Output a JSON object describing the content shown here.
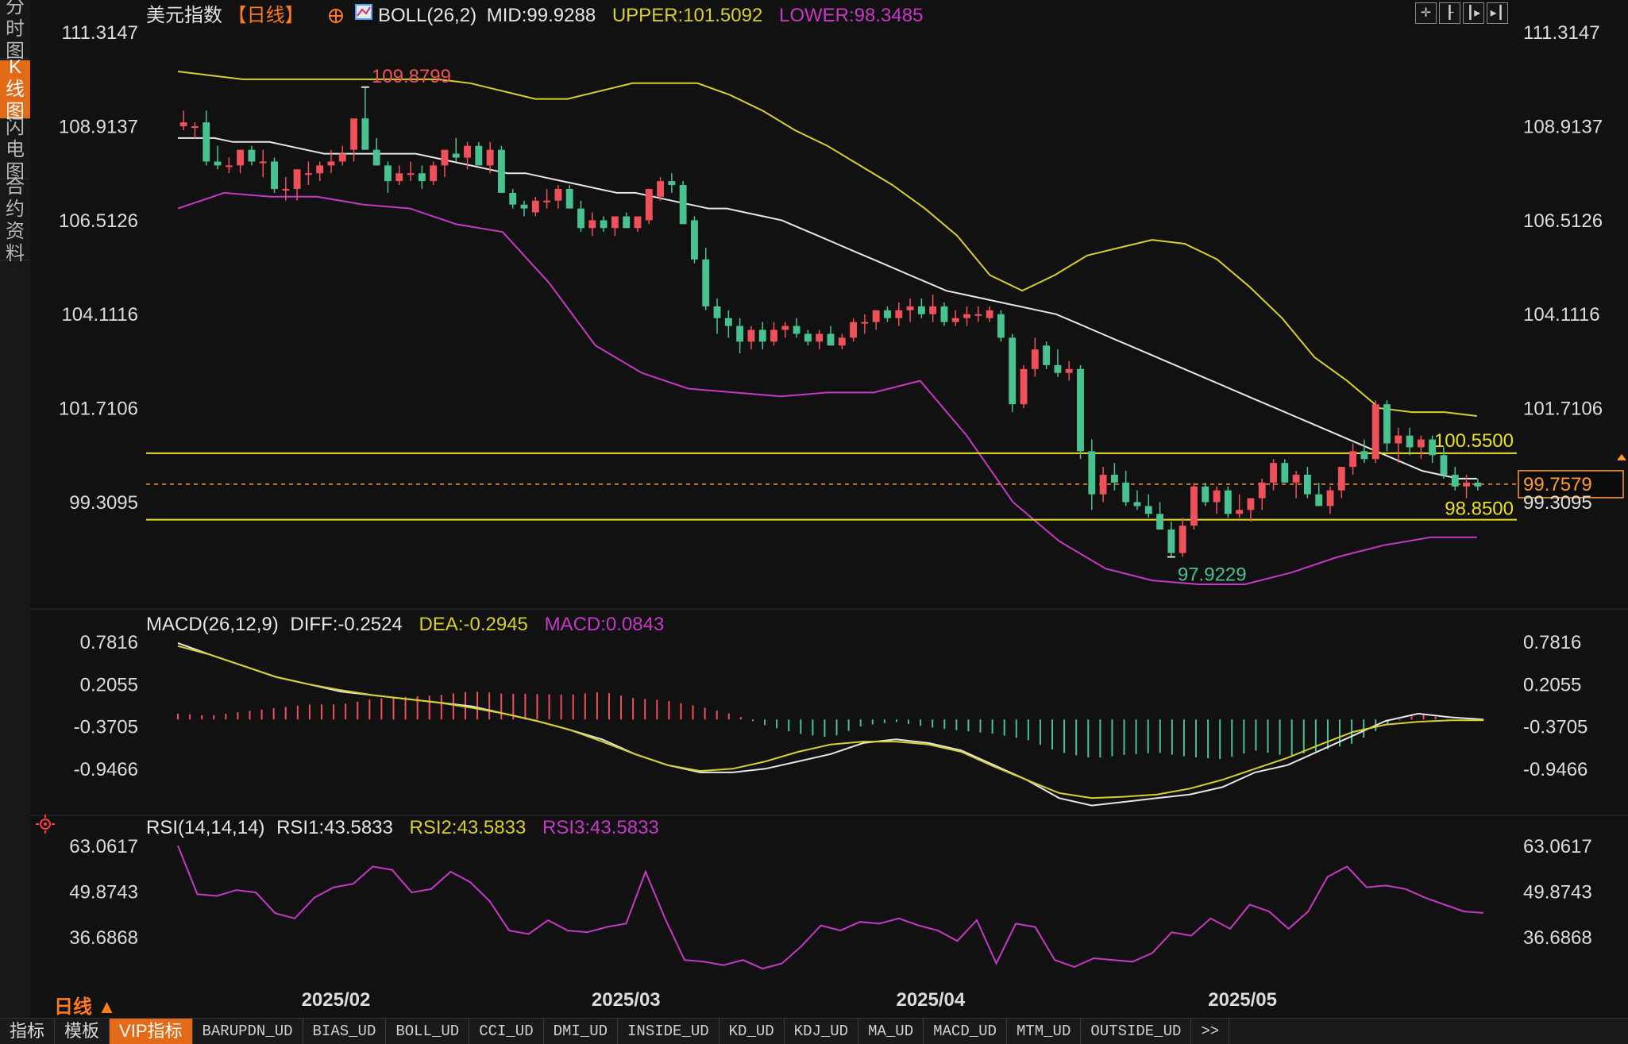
{
  "rail_tabs": [
    {
      "label": "分时图",
      "chars": [
        "分",
        "时",
        "图"
      ],
      "active": false
    },
    {
      "label": "K线图",
      "chars": [
        "K",
        "线",
        "图"
      ],
      "active": true
    },
    {
      "label": "闪电图",
      "chars": [
        "闪",
        "电",
        "图"
      ],
      "active": false
    },
    {
      "label": "合约资料",
      "chars": [
        "合",
        "约",
        "资",
        "料"
      ],
      "active": false
    }
  ],
  "header": {
    "instrument": "美元指数",
    "period_tag": "【日线】",
    "boll_label": "BOLL(26,2)",
    "boll_mid": "MID:99.9288",
    "boll_upper": "UPPER:101.5092",
    "boll_lower": "LOWER:98.3485"
  },
  "tool_icons": [
    "crosshair-icon",
    "candle-left-icon",
    "candle-right-icon",
    "candle-end-icon"
  ],
  "price_axis": {
    "ticks": [
      "111.3147",
      "108.9137",
      "106.5126",
      "104.1116",
      "101.7106",
      "99.3095"
    ],
    "tick_values": [
      111.3147,
      108.9137,
      106.5126,
      104.1116,
      101.7106,
      99.3095
    ],
    "current": "99.7579",
    "current_value": 99.7579,
    "hline_upper_label": "100.5500",
    "hline_upper_value": 100.55,
    "hline_lower_label": "98.8500",
    "hline_lower_value": 98.85,
    "high_label": "109.8799",
    "low_label": "97.9229"
  },
  "macd": {
    "label": "MACD(26,12,9)",
    "diff": "DIFF:-0.2524",
    "dea": "DEA:-0.2945",
    "macd": "MACD:0.0843",
    "ticks": [
      "0.7816",
      "0.2055",
      "-0.3705",
      "-0.9466"
    ],
    "tick_values": [
      0.7816,
      0.2055,
      -0.3705,
      -0.9466
    ]
  },
  "rsi": {
    "label": "RSI(14,14,14)",
    "rsi1": "RSI1:43.5833",
    "rsi2": "RSI2:43.5833",
    "rsi3": "RSI3:43.5833",
    "ticks": [
      "63.0617",
      "49.8743",
      "36.6868"
    ],
    "tick_values": [
      63.0617,
      49.8743,
      36.6868
    ]
  },
  "date_labels": [
    {
      "label": "2025/02",
      "index": 21
    },
    {
      "label": "2025/03",
      "index": 61
    },
    {
      "label": "2025/04",
      "index": 103
    },
    {
      "label": "2025/05",
      "index": 146
    }
  ],
  "period_toggle": "日线 ▲",
  "bottom_tabs": [
    {
      "label": "指标",
      "style": "normal",
      "active": false
    },
    {
      "label": "模板",
      "style": "normal",
      "active": false
    },
    {
      "label": "VIP指标",
      "style": "normal",
      "active": true
    },
    {
      "label": "BARUPDN_UD",
      "style": "small",
      "active": false
    },
    {
      "label": "BIAS_UD",
      "style": "small",
      "active": false
    },
    {
      "label": "BOLL_UD",
      "style": "small",
      "active": false
    },
    {
      "label": "CCI_UD",
      "style": "small",
      "active": false
    },
    {
      "label": "DMI_UD",
      "style": "small",
      "active": false
    },
    {
      "label": "INSIDE_UD",
      "style": "small",
      "active": false
    },
    {
      "label": "KD_UD",
      "style": "small",
      "active": false
    },
    {
      "label": "KDJ_UD",
      "style": "small",
      "active": false
    },
    {
      "label": "MA_UD",
      "style": "small",
      "active": false
    },
    {
      "label": "MACD_UD",
      "style": "small",
      "active": false
    },
    {
      "label": "MTM_UD",
      "style": "small",
      "active": false
    },
    {
      "label": "OUTSIDE_UD",
      "style": "small",
      "active": false
    },
    {
      "label": ">>",
      "style": "small",
      "active": false
    }
  ],
  "colors": {
    "up": "#f0505a",
    "down": "#48c290",
    "mid": "#e6e6e6",
    "upper": "#d9cf2b",
    "lower": "#c838c8",
    "hline": "#e8e020",
    "current": "#ff9a2e",
    "axis_text": "#dcdcdc",
    "accent": "#e36a16"
  },
  "chart_data": {
    "type": "candlestick",
    "ohlc": [
      [
        108.9,
        109.3,
        108.8,
        109.0
      ],
      [
        108.9,
        109.0,
        108.6,
        108.9
      ],
      [
        109.0,
        109.3,
        107.9,
        108.0
      ],
      [
        108.0,
        108.4,
        107.8,
        107.9
      ],
      [
        107.9,
        108.1,
        107.7,
        107.9
      ],
      [
        107.9,
        108.1,
        107.7,
        108.3
      ],
      [
        108.3,
        108.4,
        107.9,
        108.0
      ],
      [
        108.0,
        108.3,
        107.6,
        108.0
      ],
      [
        108.0,
        108.1,
        107.2,
        107.3
      ],
      [
        107.3,
        107.6,
        107.0,
        107.3
      ],
      [
        107.3,
        107.8,
        107.0,
        107.8
      ],
      [
        107.7,
        108.0,
        107.4,
        107.7
      ],
      [
        107.7,
        108.0,
        107.5,
        107.9
      ],
      [
        107.9,
        108.3,
        107.7,
        108.0
      ],
      [
        108.0,
        108.4,
        107.9,
        108.2
      ],
      [
        108.3,
        109.0,
        108.0,
        109.1
      ],
      [
        109.1,
        109.9,
        108.3,
        108.3
      ],
      [
        108.3,
        108.6,
        107.9,
        107.9
      ],
      [
        107.9,
        108.0,
        107.2,
        107.5
      ],
      [
        107.5,
        107.9,
        107.4,
        107.7
      ],
      [
        107.7,
        108.0,
        107.5,
        107.7
      ],
      [
        107.7,
        107.9,
        107.3,
        107.5
      ],
      [
        107.5,
        108.0,
        107.4,
        107.9
      ],
      [
        107.9,
        108.2,
        107.6,
        108.3
      ],
      [
        108.2,
        108.6,
        108.0,
        108.1
      ],
      [
        108.1,
        108.5,
        107.8,
        108.4
      ],
      [
        108.4,
        108.5,
        107.9,
        107.9
      ],
      [
        107.9,
        108.5,
        107.7,
        108.3
      ],
      [
        108.3,
        108.4,
        107.2,
        107.2
      ],
      [
        107.2,
        107.3,
        106.8,
        106.9
      ],
      [
        106.9,
        107.0,
        106.6,
        106.8
      ],
      [
        106.7,
        107.1,
        106.6,
        107.0
      ],
      [
        107.0,
        107.3,
        106.8,
        107.0
      ],
      [
        107.0,
        107.4,
        106.8,
        107.3
      ],
      [
        107.3,
        107.4,
        106.8,
        106.8
      ],
      [
        106.8,
        107.0,
        106.2,
        106.3
      ],
      [
        106.3,
        106.7,
        106.1,
        106.5
      ],
      [
        106.5,
        106.6,
        106.2,
        106.3
      ],
      [
        106.3,
        106.5,
        106.1,
        106.6
      ],
      [
        106.6,
        106.7,
        106.3,
        106.3
      ],
      [
        106.3,
        106.6,
        106.2,
        106.6
      ],
      [
        106.5,
        107.2,
        106.4,
        107.3
      ],
      [
        107.1,
        107.6,
        107.0,
        107.5
      ],
      [
        107.5,
        107.7,
        107.2,
        107.4
      ],
      [
        107.4,
        107.5,
        106.5,
        106.4
      ],
      [
        106.5,
        106.6,
        105.4,
        105.5
      ],
      [
        105.5,
        105.8,
        104.2,
        104.3
      ],
      [
        104.3,
        104.5,
        103.6,
        104.0
      ],
      [
        104.0,
        104.2,
        103.5,
        103.8
      ],
      [
        103.8,
        104.0,
        103.1,
        103.4
      ],
      [
        103.4,
        103.8,
        103.2,
        103.7
      ],
      [
        103.7,
        103.9,
        103.2,
        103.4
      ],
      [
        103.4,
        103.9,
        103.3,
        103.7
      ],
      [
        103.7,
        103.9,
        103.5,
        103.8
      ],
      [
        103.8,
        104.0,
        103.5,
        103.6
      ],
      [
        103.6,
        103.7,
        103.3,
        103.4
      ],
      [
        103.4,
        103.7,
        103.2,
        103.6
      ],
      [
        103.6,
        103.8,
        103.3,
        103.3
      ],
      [
        103.3,
        103.6,
        103.2,
        103.5
      ],
      [
        103.5,
        104.0,
        103.4,
        103.9
      ],
      [
        103.9,
        104.1,
        103.6,
        103.9
      ],
      [
        103.9,
        104.2,
        103.7,
        104.2
      ],
      [
        104.2,
        104.3,
        103.9,
        104.0
      ],
      [
        104.0,
        104.4,
        103.8,
        104.2
      ],
      [
        104.2,
        104.5,
        103.9,
        104.3
      ],
      [
        104.3,
        104.5,
        104.0,
        104.1
      ],
      [
        104.1,
        104.6,
        103.9,
        104.3
      ],
      [
        104.3,
        104.4,
        103.8,
        103.9
      ],
      [
        103.9,
        104.2,
        103.8,
        104.0
      ],
      [
        104.0,
        104.3,
        103.8,
        104.1
      ],
      [
        104.1,
        104.3,
        103.9,
        104.1
      ],
      [
        104.0,
        104.3,
        103.9,
        104.2
      ],
      [
        104.1,
        104.2,
        103.4,
        103.5
      ],
      [
        103.5,
        103.6,
        101.6,
        101.8
      ],
      [
        101.8,
        102.8,
        101.7,
        102.7
      ],
      [
        102.7,
        103.5,
        102.5,
        103.2
      ],
      [
        103.3,
        103.4,
        102.7,
        102.8
      ],
      [
        102.8,
        103.2,
        102.5,
        102.6
      ],
      [
        102.6,
        102.9,
        102.4,
        102.7
      ],
      [
        102.7,
        102.8,
        100.4,
        100.6
      ],
      [
        100.6,
        100.9,
        99.1,
        99.5
      ],
      [
        99.5,
        100.2,
        99.3,
        100.0
      ],
      [
        100.0,
        100.3,
        99.6,
        99.8
      ],
      [
        99.8,
        100.1,
        99.2,
        99.3
      ],
      [
        99.3,
        99.6,
        99.1,
        99.2
      ],
      [
        99.2,
        99.5,
        98.9,
        99.0
      ],
      [
        99.0,
        99.3,
        98.7,
        98.6
      ],
      [
        98.6,
        98.8,
        97.9,
        98.0
      ],
      [
        98.0,
        98.9,
        97.9,
        98.7
      ],
      [
        98.7,
        99.8,
        98.6,
        99.7
      ],
      [
        99.7,
        99.8,
        99.2,
        99.3
      ],
      [
        99.3,
        99.7,
        99.0,
        99.6
      ],
      [
        99.6,
        99.7,
        98.9,
        99.0
      ],
      [
        99.0,
        99.5,
        98.9,
        99.1
      ],
      [
        99.1,
        99.3,
        98.8,
        99.4
      ],
      [
        99.4,
        99.9,
        99.1,
        99.8
      ],
      [
        99.8,
        100.4,
        99.6,
        100.3
      ],
      [
        100.3,
        100.4,
        99.8,
        99.8
      ],
      [
        99.8,
        100.1,
        99.4,
        100.0
      ],
      [
        100.0,
        100.2,
        99.4,
        99.5
      ],
      [
        99.5,
        99.8,
        99.2,
        99.2
      ],
      [
        99.2,
        99.7,
        99.0,
        99.6
      ],
      [
        99.6,
        100.2,
        99.4,
        100.2
      ],
      [
        100.2,
        100.8,
        100.0,
        100.6
      ],
      [
        100.6,
        100.9,
        100.3,
        100.4
      ],
      [
        100.4,
        101.9,
        100.3,
        101.8
      ],
      [
        101.8,
        101.9,
        100.6,
        100.8
      ],
      [
        100.8,
        101.2,
        100.3,
        101.0
      ],
      [
        101.0,
        101.2,
        100.5,
        100.7
      ],
      [
        100.7,
        101.0,
        100.4,
        100.9
      ],
      [
        100.9,
        101.0,
        100.3,
        100.5
      ],
      [
        100.5,
        100.7,
        99.9,
        100.0
      ],
      [
        100.0,
        100.2,
        99.6,
        99.7
      ],
      [
        99.7,
        100.0,
        99.4,
        99.8
      ],
      [
        99.8,
        99.9,
        99.6,
        99.7
      ]
    ],
    "mid_line": [
      108.6,
      108.6,
      108.6,
      108.5,
      108.5,
      108.5,
      108.4,
      108.3,
      108.2,
      108.2,
      108.2,
      108.2,
      108.2,
      108.2,
      108.1,
      108.0,
      107.9,
      107.8,
      107.7,
      107.7,
      107.6,
      107.5,
      107.4,
      107.3,
      107.2,
      107.2,
      107.1,
      107.0,
      106.9,
      106.8,
      106.8,
      106.7,
      106.6,
      106.5,
      106.3,
      106.1,
      105.9,
      105.7,
      105.5,
      105.3,
      105.1,
      104.9,
      104.7,
      104.6,
      104.5,
      104.4,
      104.3,
      104.2,
      104.1,
      103.9,
      103.7,
      103.5,
      103.3,
      103.1,
      102.9,
      102.7,
      102.5,
      102.3,
      102.1,
      101.9,
      101.7,
      101.5,
      101.3,
      101.1,
      100.9,
      100.7,
      100.5,
      100.3,
      100.1,
      100.0,
      99.9,
      99.9
    ],
    "upper_band": [
      110.3,
      110.2,
      110.1,
      110.1,
      110.1,
      110.1,
      110.1,
      110.1,
      110.1,
      110.0,
      109.8,
      109.6,
      109.6,
      109.8,
      110.0,
      110.0,
      110.0,
      109.7,
      109.3,
      108.8,
      108.4,
      107.9,
      107.4,
      106.8,
      106.1,
      105.1,
      104.7,
      105.1,
      105.6,
      105.8,
      106.0,
      105.9,
      105.5,
      104.8,
      104.0,
      103.0,
      102.4,
      101.7,
      101.6,
      101.6,
      101.5
    ],
    "lower_band": [
      106.8,
      107.2,
      107.1,
      107.1,
      106.9,
      106.8,
      106.4,
      106.2,
      104.9,
      103.3,
      102.6,
      102.2,
      102.1,
      102.0,
      102.1,
      102.1,
      102.4,
      101.0,
      99.3,
      98.3,
      97.6,
      97.3,
      97.2,
      97.2,
      97.5,
      97.9,
      98.2,
      98.4,
      98.4
    ],
    "hlines": [
      100.55,
      98.85
    ],
    "current_price": 99.7579,
    "high": 109.8799,
    "low": 97.9229,
    "macd_diff": [
      0.76,
      0.6,
      0.45,
      0.3,
      0.2,
      0.1,
      0.05,
      0.0,
      -0.05,
      -0.1,
      -0.2,
      -0.3,
      -0.42,
      -0.55,
      -0.75,
      -0.9,
      -1.0,
      -1.0,
      -0.95,
      -0.85,
      -0.75,
      -0.6,
      -0.55,
      -0.6,
      -0.7,
      -0.9,
      -1.1,
      -1.35,
      -1.45,
      -1.4,
      -1.35,
      -1.3,
      -1.2,
      -1.0,
      -0.9,
      -0.7,
      -0.5,
      -0.3,
      -0.2,
      -0.25,
      -0.28
    ],
    "macd_dea": [
      0.72,
      0.6,
      0.45,
      0.3,
      0.2,
      0.12,
      0.05,
      0.0,
      -0.05,
      -0.12,
      -0.2,
      -0.3,
      -0.42,
      -0.58,
      -0.75,
      -0.9,
      -0.98,
      -0.95,
      -0.85,
      -0.72,
      -0.62,
      -0.58,
      -0.58,
      -0.62,
      -0.72,
      -0.92,
      -1.1,
      -1.28,
      -1.35,
      -1.33,
      -1.3,
      -1.22,
      -1.1,
      -0.95,
      -0.8,
      -0.62,
      -0.45,
      -0.35,
      -0.31,
      -0.29,
      -0.29
    ],
    "rsi": [
      63.0,
      49.0,
      48.5,
      50.2,
      49.5,
      43.5,
      42.0,
      48.0,
      51.0,
      52.0,
      57.0,
      56.0,
      49.5,
      50.5,
      55.5,
      52.5,
      47.0,
      38.5,
      37.5,
      41.5,
      38.5,
      38.0,
      39.5,
      40.5,
      55.5,
      42.0,
      30.0,
      29.5,
      28.5,
      30.0,
      27.5,
      29.0,
      34.0,
      40.0,
      38.5,
      41.0,
      40.5,
      42.0,
      40.0,
      38.5,
      35.5,
      41.5,
      29.0,
      40.5,
      39.5,
      30.0,
      28.0,
      30.5,
      30.0,
      29.5,
      32.0,
      38.0,
      37.0,
      42.0,
      39.0,
      46.0,
      44.0,
      39.0,
      44.0,
      54.0,
      57.0,
      51.0,
      51.5,
      50.5,
      48.0,
      46.0,
      44.0,
      43.6
    ]
  }
}
